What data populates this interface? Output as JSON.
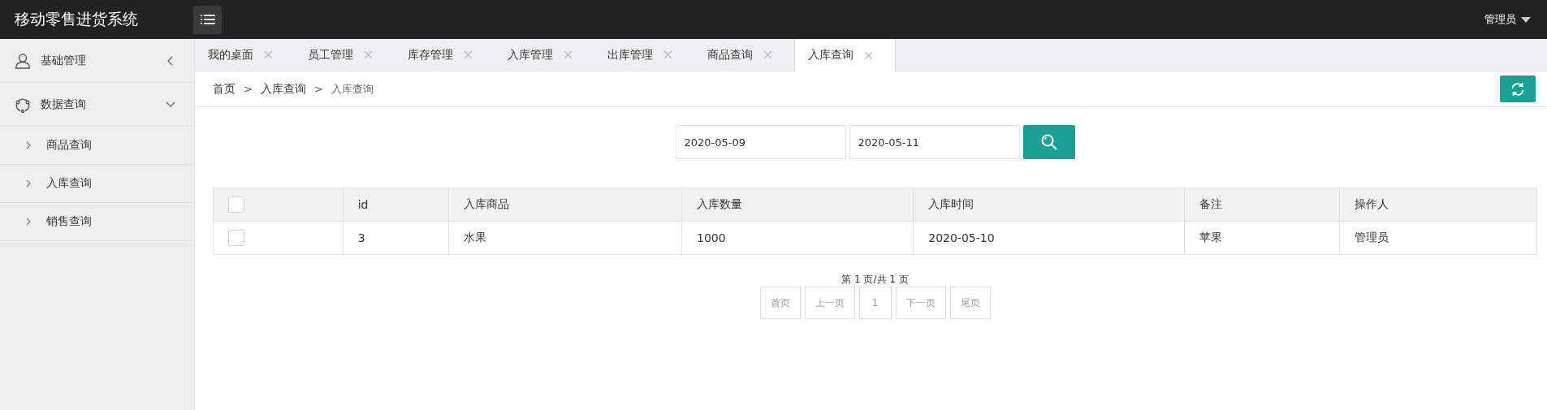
{
  "header": {
    "title": "移动零售进货系统",
    "user": "管理员"
  },
  "sidebar": {
    "items": [
      {
        "label": "基础管理",
        "kind": "user",
        "expanded": false
      },
      {
        "label": "数据查询",
        "kind": "network",
        "expanded": true,
        "children": [
          {
            "label": "商品查询"
          },
          {
            "label": "入库查询"
          },
          {
            "label": "销售查询"
          }
        ]
      }
    ]
  },
  "tabs": [
    {
      "label": "我的桌面",
      "selected": false
    },
    {
      "label": "员工管理",
      "selected": false
    },
    {
      "label": "库存管理",
      "selected": false
    },
    {
      "label": "入库管理",
      "selected": false
    },
    {
      "label": "出库管理",
      "selected": false
    },
    {
      "label": "商品查询",
      "selected": false
    },
    {
      "label": "入库查询",
      "selected": true
    }
  ],
  "breadcrumb": {
    "separator": ">",
    "items": [
      "首页",
      "入库查询",
      "入库查询"
    ]
  },
  "search": {
    "start": "2020-05-09",
    "end": "2020-05-11"
  },
  "table": {
    "columns": [
      "id",
      "入库商品",
      "入库数量",
      "入库时间",
      "备注",
      "操作人"
    ],
    "header_checked": false,
    "rows": [
      {
        "checked": false,
        "cells": [
          "3",
          "水果",
          "1000",
          "2020-05-10",
          "苹果",
          "管理员"
        ]
      }
    ]
  },
  "pagination": {
    "summary": "第 1 页/共 1 页",
    "buttons": [
      "首页",
      "上一页",
      "1",
      "下一页",
      "尾页"
    ]
  }
}
